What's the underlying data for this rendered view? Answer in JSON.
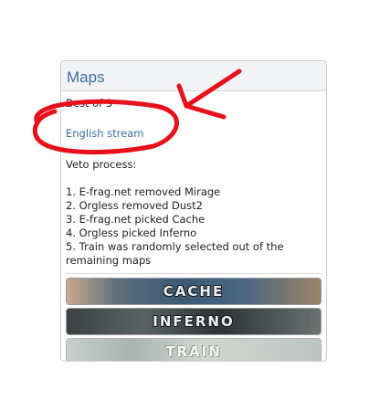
{
  "panel": {
    "title": "Maps",
    "format": "Best of 3",
    "stream_link": "English stream",
    "veto_title": "Veto process:",
    "veto_steps": [
      "1. E-frag.net removed Mirage",
      "2. Orgless removed Dust2",
      "3. E-frag.net picked Cache",
      "4. Orgless picked Inferno",
      "5. Train was randomly selected out of the",
      "remaining maps"
    ]
  },
  "maps": [
    {
      "label": "CACHE"
    },
    {
      "label": "INFERNO"
    },
    {
      "label": "TRAIN"
    }
  ],
  "annotation": {
    "color": "#e8101a"
  }
}
